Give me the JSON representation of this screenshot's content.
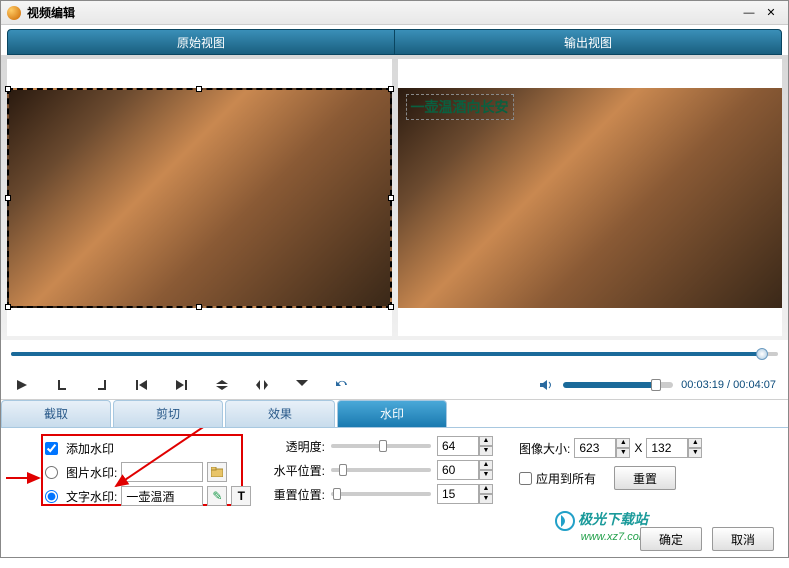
{
  "window": {
    "title": "视频编辑"
  },
  "header": {
    "left": "原始视图",
    "right": "输出视图"
  },
  "watermark_text_overlay": "一壶温酒向长安",
  "time": {
    "current": "00:03:19",
    "total": "00:04:07"
  },
  "tabs": {
    "crop": "截取",
    "cut": "剪切",
    "effect": "效果",
    "watermark": "水印"
  },
  "options": {
    "add_watermark": "添加水印",
    "image_watermark": "图片水印:",
    "text_watermark": "文字水印:",
    "text_watermark_value": "一壶温酒",
    "transparency": "透明度:",
    "transparency_value": "64",
    "h_position": "水平位置:",
    "h_position_value": "60",
    "v_position": "重置位置:",
    "v_position_value": "15",
    "image_size": "图像大小:",
    "width": "623",
    "x": "X",
    "height": "132",
    "apply_all": "应用到所有",
    "reset": "重置"
  },
  "buttons": {
    "ok": "确定",
    "cancel": "取消"
  },
  "branding": {
    "name": "极光下载站",
    "url": "www.xz7.com"
  }
}
